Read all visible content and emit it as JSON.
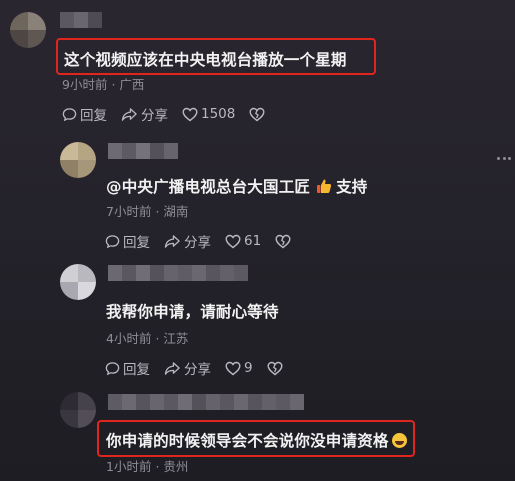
{
  "comments": [
    {
      "text": "这个视频应该在中央电视台播放一个星期",
      "time": "9小时前",
      "location": "广西",
      "reply_label": "回复",
      "share_label": "分享",
      "likes": "1508"
    },
    {
      "text": "@中央广播电视总台大国工匠",
      "text_suffix": "支持",
      "time": "7小时前",
      "location": "湖南",
      "reply_label": "回复",
      "share_label": "分享",
      "likes": "61"
    },
    {
      "text": "我帮你申请，请耐心等待",
      "time": "4小时前",
      "location": "江苏",
      "reply_label": "回复",
      "share_label": "分享",
      "likes": "9"
    },
    {
      "text": "你申请的时候领导会不会说你没申请资格",
      "time": "1小时前",
      "location": "贵州"
    }
  ],
  "separator": "·",
  "icons": {
    "reply": "speech-bubble-icon",
    "share": "share-arrow-icon",
    "like": "heart-icon",
    "dislike": "broken-heart-icon",
    "more": "more-dots-icon",
    "thumbs_up": "thumbs-up-emoji",
    "laughing": "rolling-laughing-emoji"
  },
  "colors": {
    "highlight_border": "#e0241e",
    "meta_text": "#8e8c95"
  }
}
